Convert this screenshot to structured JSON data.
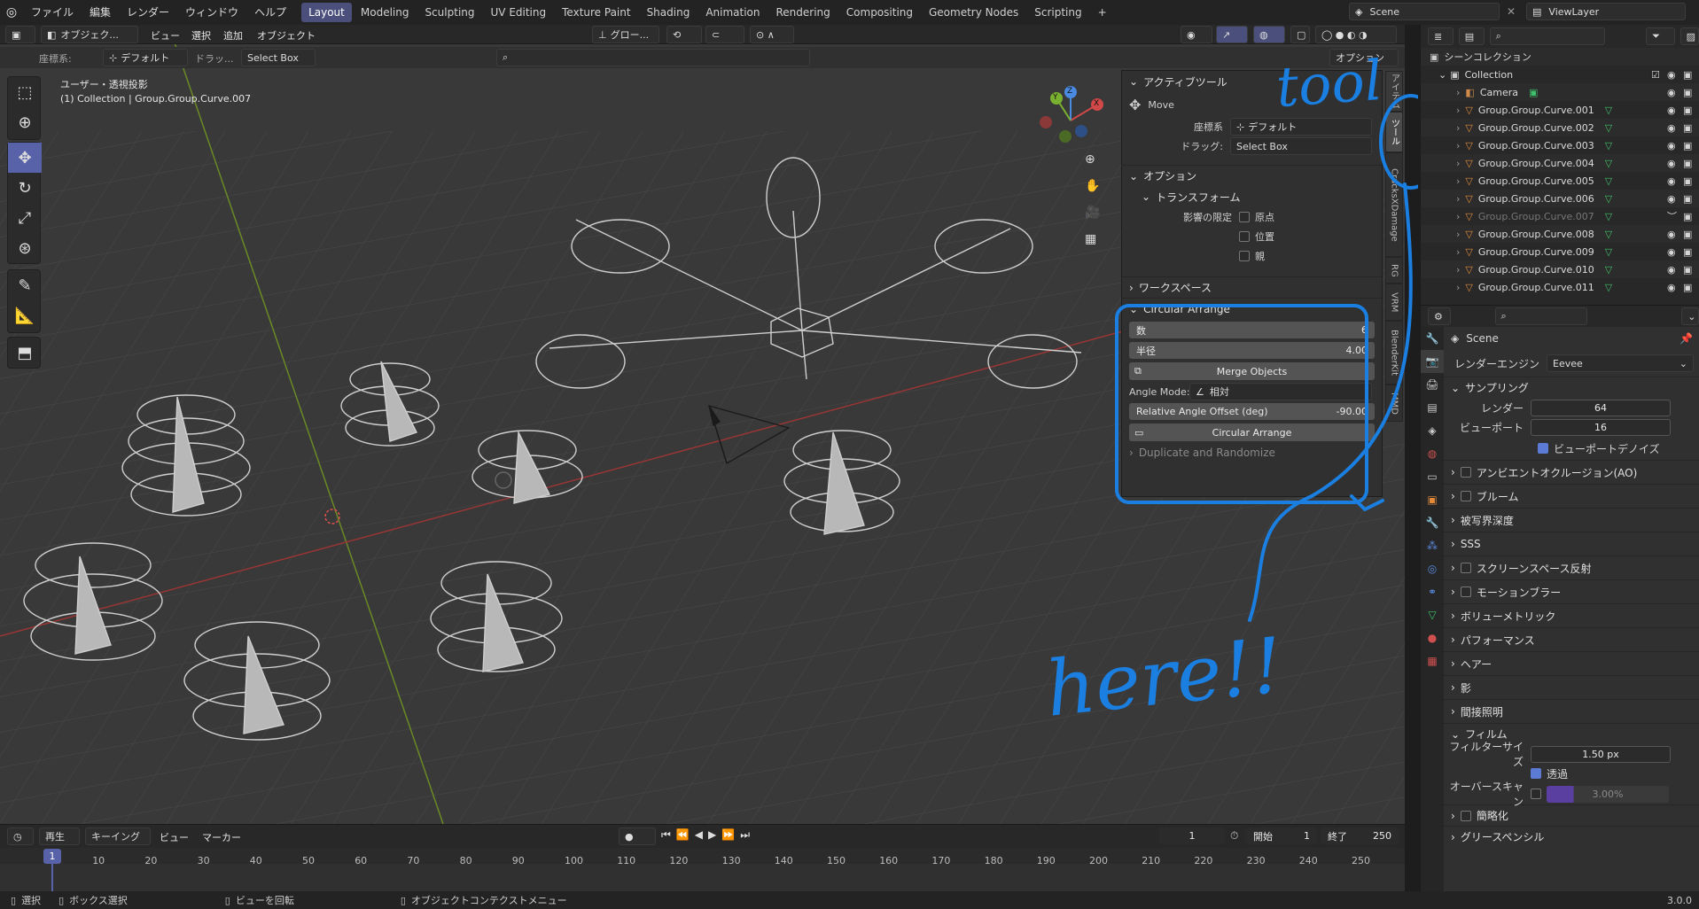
{
  "menubar": {
    "items": [
      "ファイル",
      "編集",
      "レンダー",
      "ウィンドウ",
      "ヘルプ"
    ],
    "workspaces": [
      "Layout",
      "Modeling",
      "Sculpting",
      "UV Editing",
      "Texture Paint",
      "Shading",
      "Animation",
      "Rendering",
      "Compositing",
      "Geometry Nodes",
      "Scripting"
    ],
    "active_workspace": "Layout",
    "add_tab": "+",
    "scene": "Scene",
    "view_layer": "ViewLayer"
  },
  "viewport_header": {
    "mode": "オブジェク...",
    "menus": [
      "ビュー",
      "選択",
      "追加",
      "オブジェクト"
    ],
    "orientation": "グロー...",
    "options_label": "オプション"
  },
  "tool_settings": {
    "coordinate_label": "座標系:",
    "coordinate_value": "デフォルト",
    "drag_label": "ドラッ...",
    "drag_value": "Select Box"
  },
  "viewport_info": {
    "line1": "ユーザー・透視投影",
    "line2": "(1) Collection | Group.Group.Curve.007"
  },
  "gizmo": {
    "x": "X",
    "y": "Y",
    "z": "Z"
  },
  "npanel": {
    "active_tool": {
      "title": "アクティブツール",
      "tool_name": "Move",
      "coord_label": "座標系",
      "coord_value": "デフォルト",
      "drag_label": "ドラッグ:",
      "drag_value": "Select Box"
    },
    "options": {
      "title": "オプション",
      "transform_title": "トランスフォーム",
      "affect_only_label": "影響の限定",
      "checkboxes": [
        "原点",
        "位置",
        "親"
      ]
    },
    "workspace_title": "ワークスペース",
    "circular_arrange": {
      "title": "Circular Arrange",
      "count_label": "数",
      "count_value": "6",
      "radius_label": "半径",
      "radius_value": "4.00",
      "merge_label": "Merge Objects",
      "angle_mode_label": "Angle Mode:",
      "angle_mode_value": "相対",
      "offset_label": "Relative Angle Offset (deg)",
      "offset_value": "-90.00",
      "run_label": "Circular Arrange"
    },
    "next_section_partial": "Duplicate and Randomize",
    "tabs": [
      "アイテム",
      "ツール",
      "CracksXDamage",
      "RG",
      "VRM",
      "BlenderKit",
      "MMD"
    ]
  },
  "annotations": {
    "tool": "tool",
    "here": "here!!"
  },
  "outliner": {
    "scene_collection": "シーンコレクション",
    "collection": "Collection",
    "items": [
      "Camera",
      "Group.Group.Curve.001",
      "Group.Group.Curve.002",
      "Group.Group.Curve.003",
      "Group.Group.Curve.004",
      "Group.Group.Curve.005",
      "Group.Group.Curve.006",
      "Group.Group.Curve.007",
      "Group.Group.Curve.008",
      "Group.Group.Curve.009",
      "Group.Group.Curve.010",
      "Group.Group.Curve.011"
    ],
    "disabled_item": "Group.Group.Curve.007"
  },
  "properties": {
    "scene_label": "Scene",
    "render_engine_label": "レンダーエンジン",
    "render_engine_value": "Eevee",
    "sampling_title": "サンプリング",
    "render_label": "レンダー",
    "render_value": "64",
    "viewport_label": "ビューポート",
    "viewport_value": "16",
    "viewport_denoise": "ビューポートデノイズ",
    "sections": [
      "アンビエントオクルージョン(AO)",
      "ブルーム",
      "被写界深度",
      "SSS",
      "スクリーンスペース反射",
      "モーションブラー",
      "ボリューメトリック",
      "パフォーマンス",
      "ヘアー",
      "影",
      "間接照明"
    ],
    "film_title": "フィルム",
    "filter_size_label": "フィルターサイズ",
    "filter_size_value": "1.50 px",
    "transparent_label": "透過",
    "overscan_label": "オーバースキャン",
    "overscan_value": "3.00%",
    "simplify_title": "簡略化",
    "grease_pencil_title": "グリースペンシル"
  },
  "timeline": {
    "playback": "再生",
    "keying": "キーイング",
    "view": "ビュー",
    "marker": "マーカー",
    "current_frame": "1",
    "start_label": "開始",
    "start_value": "1",
    "end_label": "終了",
    "end_value": "250",
    "frame_marker": "1",
    "ticks": [
      "10",
      "20",
      "30",
      "40",
      "50",
      "60",
      "70",
      "80",
      "90",
      "100",
      "110",
      "120",
      "130",
      "140",
      "150",
      "160",
      "170",
      "180",
      "190",
      "200",
      "210",
      "220",
      "230",
      "240",
      "250"
    ]
  },
  "statusbar": {
    "select": "選択",
    "box_select": "ボックス選択",
    "rotate_view": "ビューを回転",
    "context_menu": "オブジェクトコンテクストメニュー",
    "version": "3.0.0"
  },
  "colors": {
    "accent": "#5862a8",
    "annotation_blue": "#1a7fe0",
    "x_axis": "#a33a3a",
    "y_axis": "#7aa12a"
  }
}
